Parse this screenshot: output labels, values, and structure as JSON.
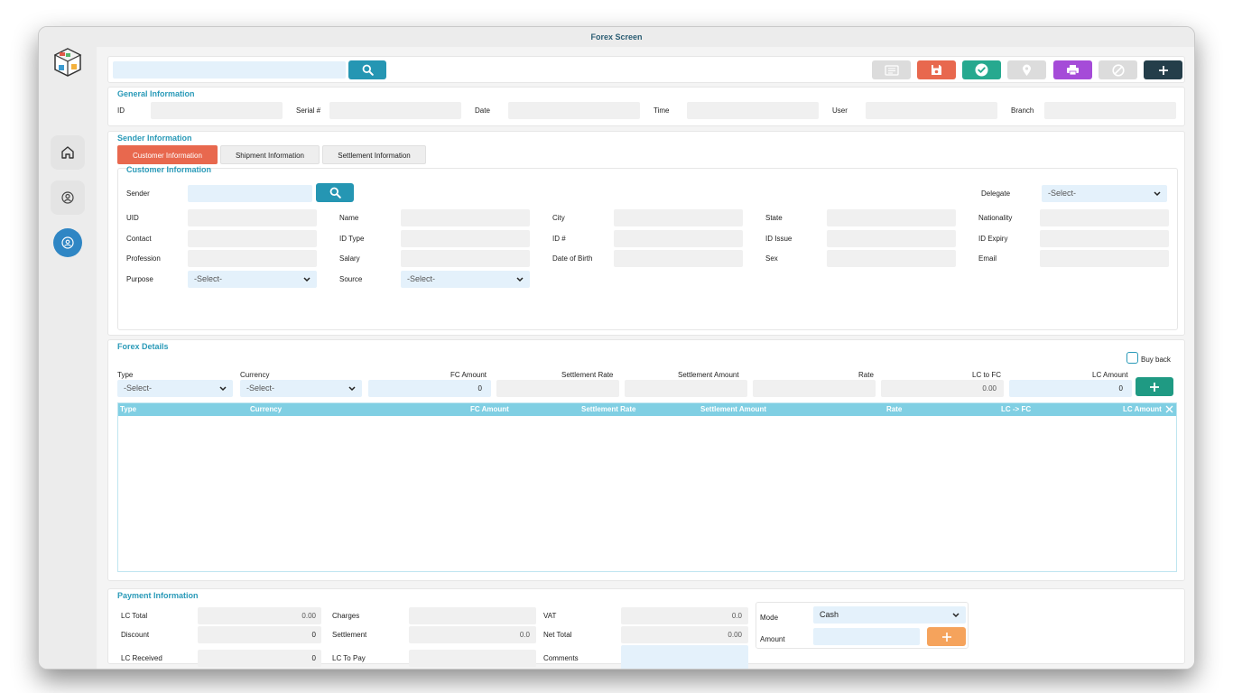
{
  "window": {
    "title": "Forex Screen"
  },
  "toolbar": {
    "search_value": ""
  },
  "general": {
    "title": "General Information",
    "labels": [
      "ID",
      "Serial #",
      "Date",
      "Time",
      "User",
      "Branch"
    ]
  },
  "sender": {
    "title": "Sender Information",
    "tabs": [
      "Customer Information",
      "Shipment Information",
      "Settlement Information"
    ],
    "customer_title": "Customer Information",
    "sender_label": "Sender",
    "delegate_label": "Delegate",
    "delegate_value": "-Select-",
    "row1": [
      "UID",
      "Name",
      "City",
      "State",
      "Nationality"
    ],
    "row2": [
      "Contact",
      "ID Type",
      "ID #",
      "ID Issue",
      "ID Expiry"
    ],
    "row3": [
      "Profession",
      "Salary",
      "Date of Birth",
      "Sex",
      "Email"
    ],
    "purpose_label": "Purpose",
    "purpose_value": "-Select-",
    "source_label": "Source",
    "source_value": "-Select-"
  },
  "forex": {
    "title": "Forex Details",
    "buyback_label": "Buy back",
    "labels": {
      "type": "Type",
      "currency": "Currency",
      "fc_amount": "FC Amount",
      "settlement_rate": "Settlement Rate",
      "settlement_amount": "Settlement Amount",
      "rate": "Rate",
      "lc_to_fc": "LC to FC",
      "lc_amount": "LC Amount"
    },
    "type_value": "-Select-",
    "currency_value": "-Select-",
    "fc_amount_value": "0",
    "lc_to_fc_value": "0.00",
    "lc_amount_value": "0",
    "columns": [
      "Type",
      "Currency",
      "FC Amount",
      "Settlement Rate",
      "Settlement Amount",
      "Rate",
      "LC -> FC",
      "LC Amount"
    ]
  },
  "payment": {
    "title": "Payment Information",
    "lc_total_label": "LC Total",
    "lc_total_value": "0.00",
    "discount_label": "Discount",
    "discount_value": "0",
    "lc_received_label": "LC Received",
    "lc_received_value": "0",
    "charges_label": "Charges",
    "settlement_label": "Settlement",
    "settlement_value": "0.0",
    "lc_to_pay_label": "LC To Pay",
    "vat_label": "VAT",
    "vat_value": "0.0",
    "net_total_label": "Net Total",
    "net_total_value": "0.00",
    "comments_label": "Comments",
    "mode_label": "Mode",
    "mode_value": "Cash",
    "amount_label": "Amount"
  },
  "colors": {
    "accent": "#2a9ab8",
    "search_button": "#2596b3",
    "save_button": "#e8684e",
    "approve_button": "#26a98f",
    "print_button": "#a54bd8",
    "add_button": "#243e4a",
    "add_row_button": "#1f9a83",
    "payment_add_button": "#f5a35c",
    "active_tab": "#e8684e"
  },
  "icons": [
    "logo-icon",
    "home-icon",
    "user-icon",
    "customer-icon",
    "search-icon",
    "list-icon",
    "save-icon",
    "check-icon",
    "location-icon",
    "print-icon",
    "cancel-icon",
    "plus-icon",
    "chevron-down-icon",
    "close-icon"
  ]
}
